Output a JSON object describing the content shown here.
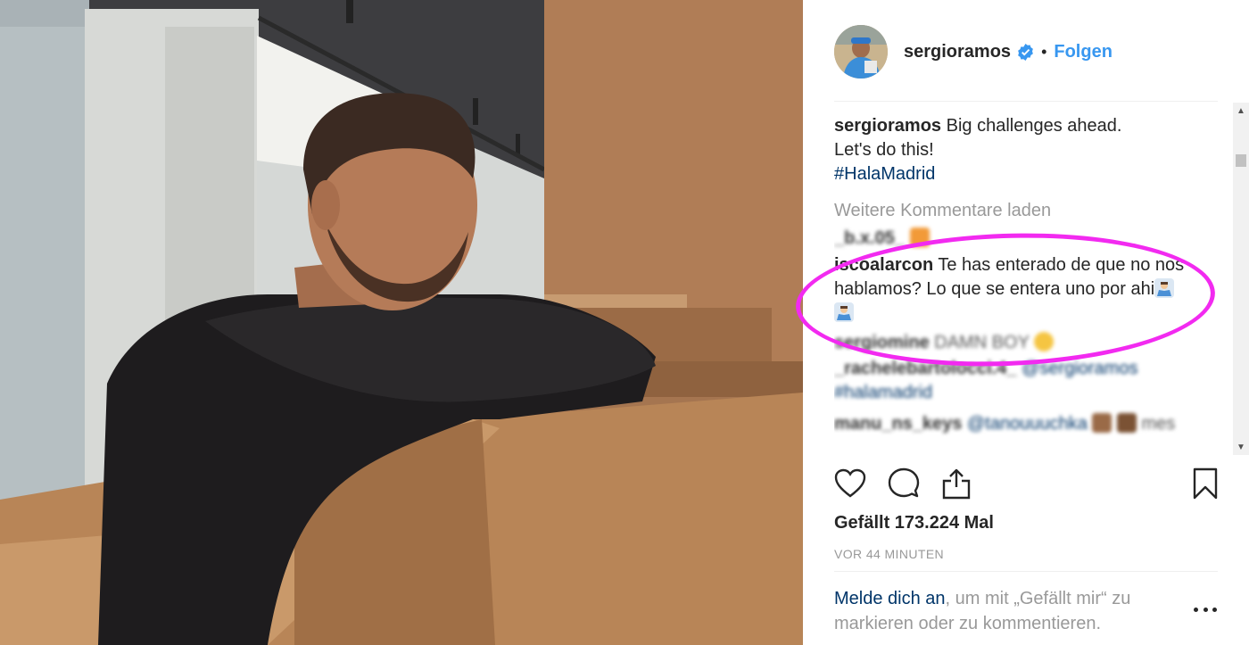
{
  "post": {
    "username": "sergioramos",
    "follow_label": "Folgen",
    "separator": "•",
    "caption_text_line1": "Big challenges ahead.",
    "caption_text_line2": "Let's do this!",
    "caption_hashtag": "#HalaMadrid",
    "load_more_label": "Weitere Kommentare laden",
    "likes_label": "Gefällt 173.224 Mal",
    "timestamp": "VOR 44 MINUTEN"
  },
  "comments": [
    {
      "username": "_b.x.05_",
      "text": ""
    },
    {
      "username": "iscoalarcon",
      "text": "Te has enterado de que no nos hablamos? Lo que se entera uno por ahi"
    },
    {
      "username": "sergiomine",
      "text": "DAMN BOY"
    },
    {
      "username": "_rachelebartolocci.4_",
      "text": "@sergioramos",
      "text2": "#halamadrid"
    },
    {
      "username": "manu_ns_keys",
      "text": "@tanouuuchka",
      "text2": "mes"
    }
  ],
  "login_prompt": {
    "link": "Melde dich an",
    "text": ", um mit „Gefällt mir“ zu markieren oder zu kommentieren."
  },
  "icons": {
    "like": "heart-icon",
    "comment": "comment-icon",
    "share": "share-icon",
    "save": "bookmark-icon",
    "more": "more-options-icon",
    "verified": "verified-badge-icon"
  },
  "colors": {
    "accent": "#3897f0",
    "link": "#003569",
    "highlight": "#f22af0",
    "muted": "#999999"
  }
}
